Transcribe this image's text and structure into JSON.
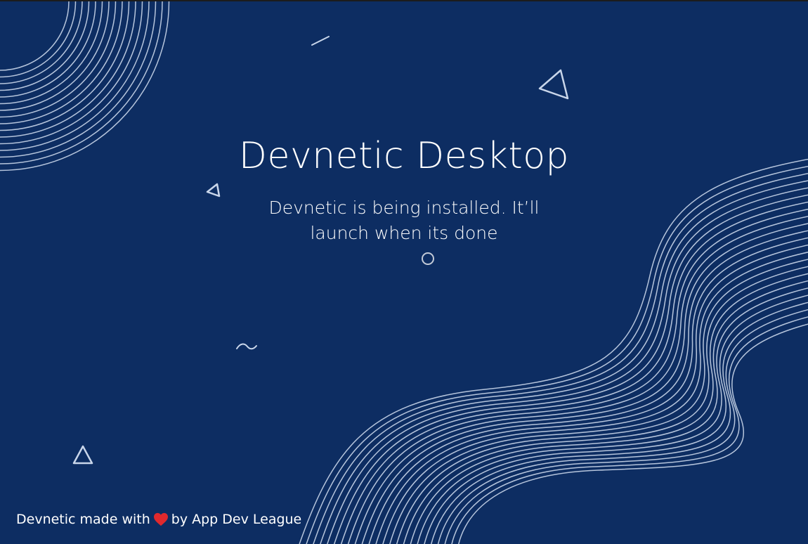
{
  "window": {
    "background_color": "#0d2d62"
  },
  "installer": {
    "title": "Devnetic Desktop",
    "message": "Devnetic is being installed. It’ll launch when its done",
    "spinner_icon": "loading-spinner-icon"
  },
  "footer": {
    "text_before": "Devnetic made with",
    "icon": "heart-icon",
    "icon_color": "#e0292d",
    "text_after": "by App Dev League"
  },
  "decoration": {
    "line_color": "#c9d6ea",
    "shapes": [
      "triangle-icon",
      "triangle-icon",
      "triangle-icon",
      "dash-icon",
      "tilde-icon"
    ]
  }
}
